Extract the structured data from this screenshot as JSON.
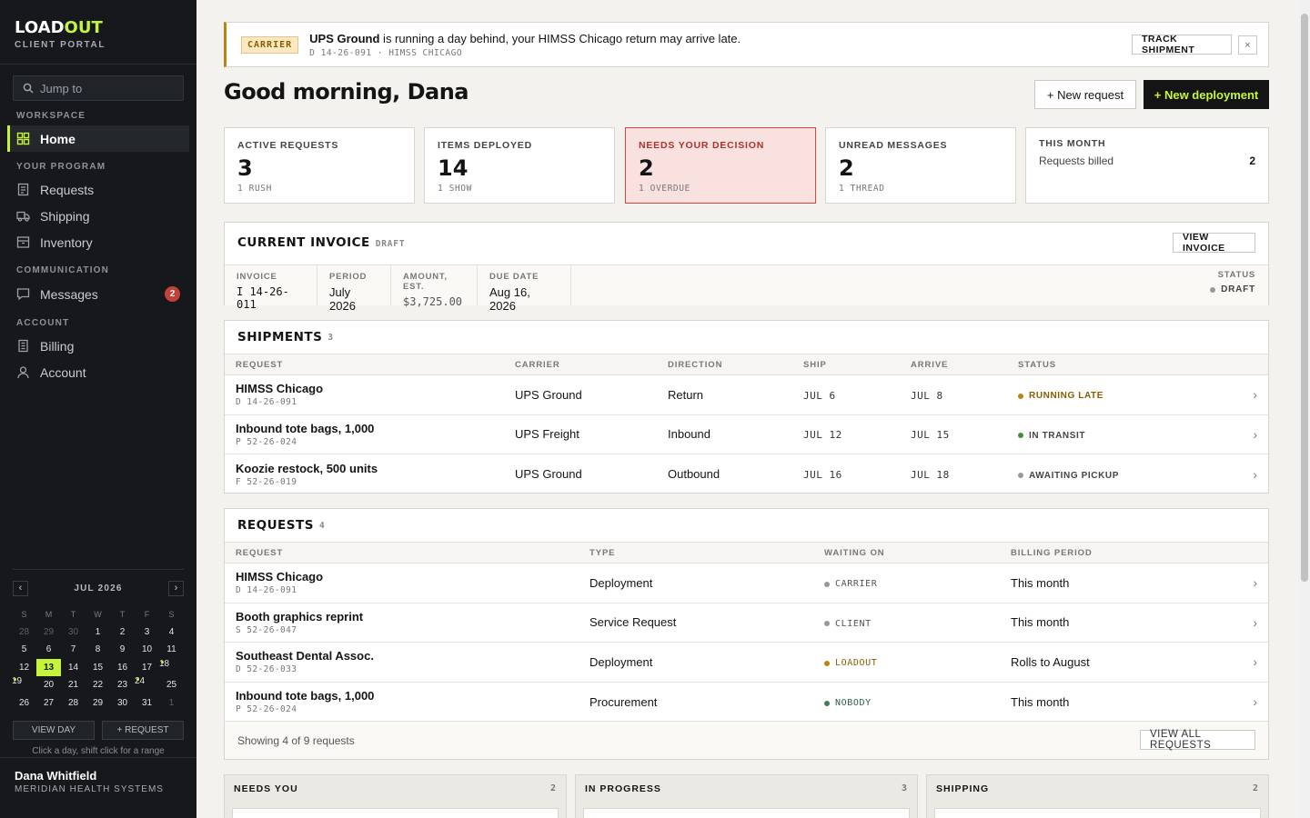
{
  "brand": {
    "name_a": "LOAD",
    "name_b": "OUT",
    "subtitle": "CLIENT PORTAL"
  },
  "search": {
    "placeholder": "Jump to"
  },
  "sidebar": {
    "sections": {
      "workspace": "WORKSPACE",
      "program": "YOUR PROGRAM",
      "communication": "COMMUNICATION",
      "account": "ACCOUNT"
    },
    "items": {
      "home": "Home",
      "requests": "Requests",
      "shipping": "Shipping",
      "inventory": "Inventory",
      "messages": "Messages",
      "messages_badge": "2",
      "billing": "Billing",
      "account": "Account"
    }
  },
  "calendar": {
    "month": "JUL 2026",
    "prev": "‹",
    "next": "›",
    "dow": [
      "S",
      "M",
      "T",
      "W",
      "T",
      "F",
      "S"
    ],
    "days": [
      {
        "d": "28",
        "out": true
      },
      {
        "d": "29",
        "out": true
      },
      {
        "d": "30",
        "out": true
      },
      {
        "d": "1"
      },
      {
        "d": "2"
      },
      {
        "d": "3"
      },
      {
        "d": "4"
      },
      {
        "d": "5"
      },
      {
        "d": "6"
      },
      {
        "d": "7"
      },
      {
        "d": "8"
      },
      {
        "d": "9"
      },
      {
        "d": "10"
      },
      {
        "d": "11"
      },
      {
        "d": "12"
      },
      {
        "d": "13",
        "today": true
      },
      {
        "d": "14"
      },
      {
        "d": "15"
      },
      {
        "d": "16"
      },
      {
        "d": "17"
      },
      {
        "d": "18",
        "dot": true
      },
      {
        "d": "19",
        "dot": true
      },
      {
        "d": "20"
      },
      {
        "d": "21"
      },
      {
        "d": "22"
      },
      {
        "d": "23"
      },
      {
        "d": "24",
        "dot": true
      },
      {
        "d": "25"
      },
      {
        "d": "26"
      },
      {
        "d": "27"
      },
      {
        "d": "28"
      },
      {
        "d": "29"
      },
      {
        "d": "30"
      },
      {
        "d": "31"
      },
      {
        "d": "1",
        "out": true
      }
    ],
    "view_day": "VIEW DAY",
    "add_request": "+ REQUEST",
    "hint": "Click a day, shift click for a range"
  },
  "user": {
    "name": "Dana Whitfield",
    "org": "MERIDIAN HEALTH SYSTEMS"
  },
  "banner": {
    "tag": "CARRIER",
    "carrier": "UPS Ground",
    "message": " is running a day behind, your HIMSS Chicago return may arrive late.",
    "meta": "D 14-26-091 · HIMSS CHICAGO",
    "track": "TRACK SHIPMENT",
    "close": "×"
  },
  "greeting": "Good morning, Dana",
  "actions": {
    "new_request": "+ New request",
    "new_deployment": "+ New deployment"
  },
  "stats": [
    {
      "label": "ACTIVE REQUESTS",
      "value": "3",
      "sub": "1 RUSH"
    },
    {
      "label": "ITEMS DEPLOYED",
      "value": "14",
      "sub": "1 SHOW"
    },
    {
      "label": "NEEDS YOUR DECISION",
      "value": "2",
      "sub": "1 OVERDUE"
    },
    {
      "label": "UNREAD MESSAGES",
      "value": "2",
      "sub": "1 THREAD"
    }
  ],
  "this_month": {
    "label": "THIS MONTH",
    "row_label": "Requests billed",
    "row_value": "2"
  },
  "invoice": {
    "title": "CURRENT INVOICE",
    "state_tag": "DRAFT",
    "view": "VIEW INVOICE",
    "fields": [
      {
        "label": "INVOICE",
        "value": "I 14-26-011",
        "mono": true
      },
      {
        "label": "PERIOD",
        "value": "July 2026"
      },
      {
        "label": "AMOUNT, EST.",
        "value": "$3,725.00",
        "mono": true
      },
      {
        "label": "DUE DATE",
        "value": "Aug 16, 2026"
      }
    ],
    "status_label": "STATUS",
    "status_value": "DRAFT"
  },
  "shipments": {
    "title": "SHIPMENTS",
    "count": "3",
    "columns": [
      "REQUEST",
      "CARRIER",
      "DIRECTION",
      "SHIP",
      "ARRIVE",
      "STATUS"
    ],
    "rows": [
      {
        "title": "HIMSS Chicago",
        "ref": "D 14-26-091",
        "carrier": "UPS Ground",
        "direction": "Return",
        "ship": "JUL 6",
        "arrive": "JUL 8",
        "status": "RUNNING LATE",
        "color": "#b88512"
      },
      {
        "title": "Inbound tote bags, 1,000",
        "ref": "P 52-26-024",
        "carrier": "UPS Freight",
        "direction": "Inbound",
        "ship": "JUL 12",
        "arrive": "JUL 15",
        "status": "IN TRANSIT",
        "color": "#4a8a3c"
      },
      {
        "title": "Koozie restock, 500 units",
        "ref": "F 52-26-019",
        "carrier": "UPS Ground",
        "direction": "Outbound",
        "ship": "JUL 16",
        "arrive": "JUL 18",
        "status": "AWAITING PICKUP",
        "color": "#999999"
      }
    ]
  },
  "requests": {
    "title": "REQUESTS",
    "count": "4",
    "columns": [
      "REQUEST",
      "TYPE",
      "WAITING ON",
      "BILLING PERIOD"
    ],
    "rows": [
      {
        "title": "HIMSS Chicago",
        "ref": "D 14-26-091",
        "type": "Deployment",
        "waiting": "CARRIER",
        "billing": "This month",
        "color": "#999999"
      },
      {
        "title": "Booth graphics reprint",
        "ref": "S 52-26-047",
        "type": "Service Request",
        "waiting": "CLIENT",
        "billing": "This month",
        "color": "#999999"
      },
      {
        "title": "Southeast Dental Assoc.",
        "ref": "D 52-26-033",
        "type": "Deployment",
        "waiting": "LOADOUT",
        "billing": "Rolls to August",
        "color": "#b88512"
      },
      {
        "title": "Inbound tote bags, 1,000",
        "ref": "P 52-26-024",
        "type": "Procurement",
        "waiting": "NOBODY",
        "billing": "This month",
        "color": "#3f7d5c"
      }
    ],
    "footer": "Showing 4 of 9 requests",
    "view_all": "VIEW ALL REQUESTS"
  },
  "boards": [
    {
      "title": "NEEDS YOU",
      "count": "2"
    },
    {
      "title": "IN PROGRESS",
      "count": "3"
    },
    {
      "title": "SHIPPING",
      "count": "2"
    }
  ],
  "colors": {
    "accent": "#c5f53b",
    "sidebar": "#16181b",
    "alert": "#d9453c",
    "warning": "#b88512"
  }
}
